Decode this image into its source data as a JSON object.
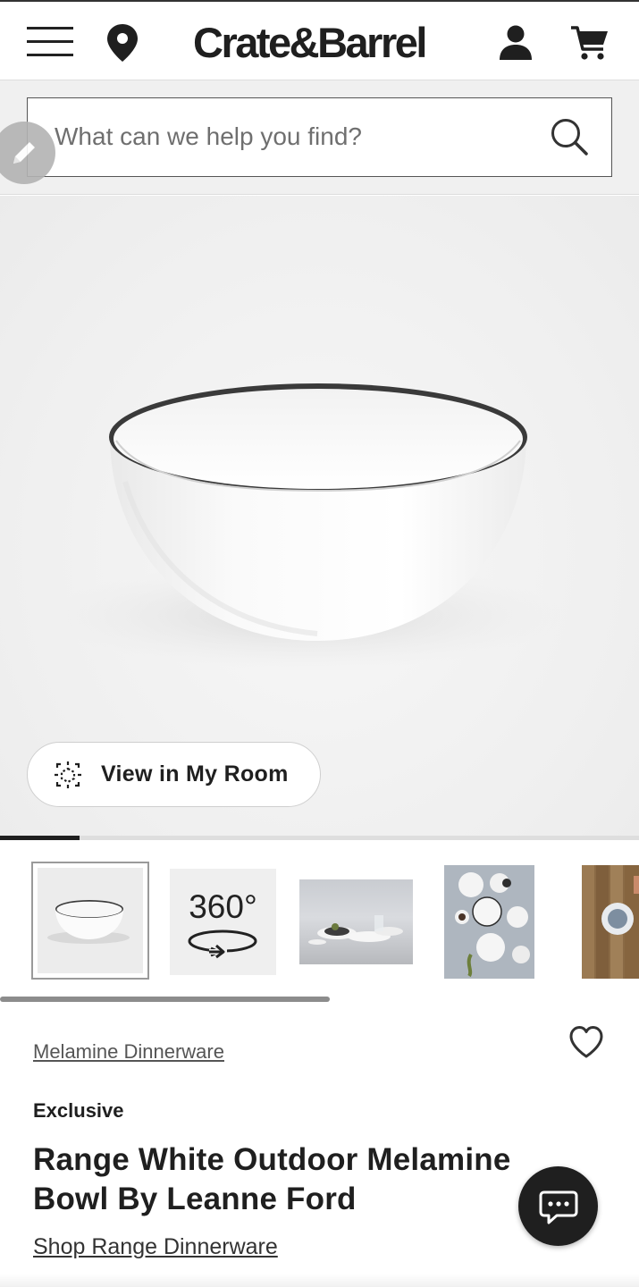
{
  "header": {
    "logo_text": "Crate&Barrel",
    "icons": [
      "menu-icon",
      "location-pin-icon",
      "account-icon",
      "cart-icon"
    ]
  },
  "search": {
    "placeholder": "What can we help you find?",
    "icon": "search-icon"
  },
  "hero": {
    "view_in_room_label": "View in My Room",
    "image_progress_fraction": 0.125
  },
  "thumbnails": {
    "items": [
      {
        "kind": "image",
        "selected": true
      },
      {
        "kind": "360",
        "label": "360°"
      },
      {
        "kind": "image",
        "selected": false
      },
      {
        "kind": "image",
        "selected": false
      },
      {
        "kind": "image",
        "selected": false
      }
    ]
  },
  "product": {
    "collection_link": "Melamine Dinnerware",
    "badge": "Exclusive",
    "title": "Range White Outdoor Melamine Bowl By Leanne Ford",
    "shop_link": "Shop Range Dinnerware"
  },
  "colors": {
    "text": "#1f1f1f",
    "background": "#ffffff",
    "band": "#f0f0f0"
  }
}
